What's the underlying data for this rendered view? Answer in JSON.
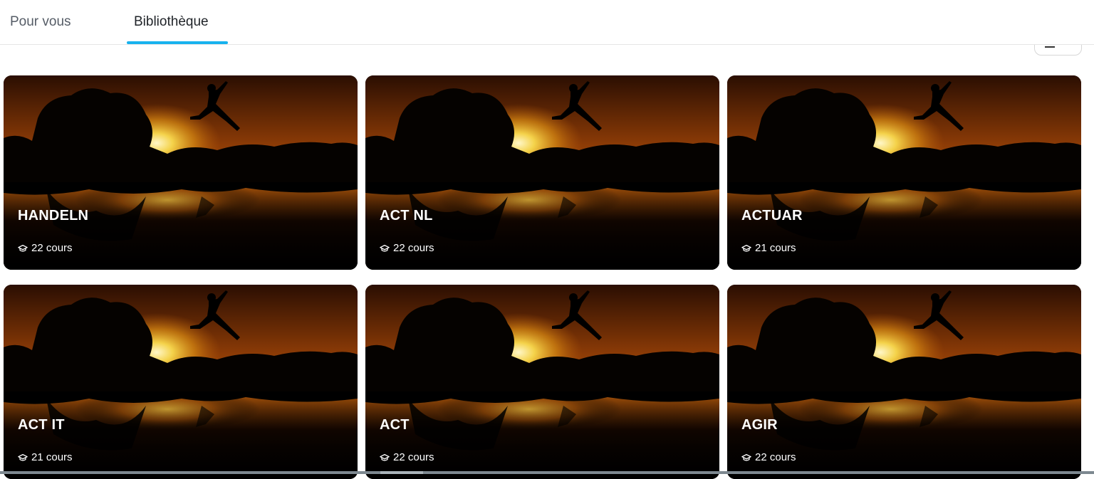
{
  "tabs": [
    {
      "label": "Pour vous"
    },
    {
      "label": "Bibliothèque",
      "active": true
    }
  ],
  "accent_color": "#17b2ee",
  "sort_icon": "sort-icon",
  "cards": [
    {
      "title": "HANDELN",
      "count": "22 cours"
    },
    {
      "title": "ACT NL",
      "count": "22 cours"
    },
    {
      "title": "ACTUAR",
      "count": "21 cours"
    },
    {
      "title": "ACT IT",
      "count": "21 cours"
    },
    {
      "title": "ACT",
      "count": "22 cours"
    },
    {
      "title": "AGIR",
      "count": "22 cours"
    }
  ],
  "card_icon": "graduation-cap-icon"
}
